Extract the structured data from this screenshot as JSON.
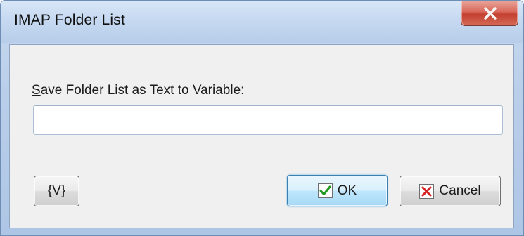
{
  "window": {
    "title": "IMAP Folder List"
  },
  "form": {
    "label_mnemonic": "S",
    "label_rest": "ave Folder List as Text to Variable:",
    "input_value": ""
  },
  "buttons": {
    "variable_label": "{V}",
    "ok_label": "OK",
    "cancel_label": "Cancel"
  },
  "icons": {
    "close": "close-x-icon",
    "ok": "checkmark-icon",
    "cancel": "red-x-icon"
  },
  "colors": {
    "check_green": "#1f9a1f",
    "cancel_red": "#d42222",
    "close_red": "#c43f30"
  }
}
